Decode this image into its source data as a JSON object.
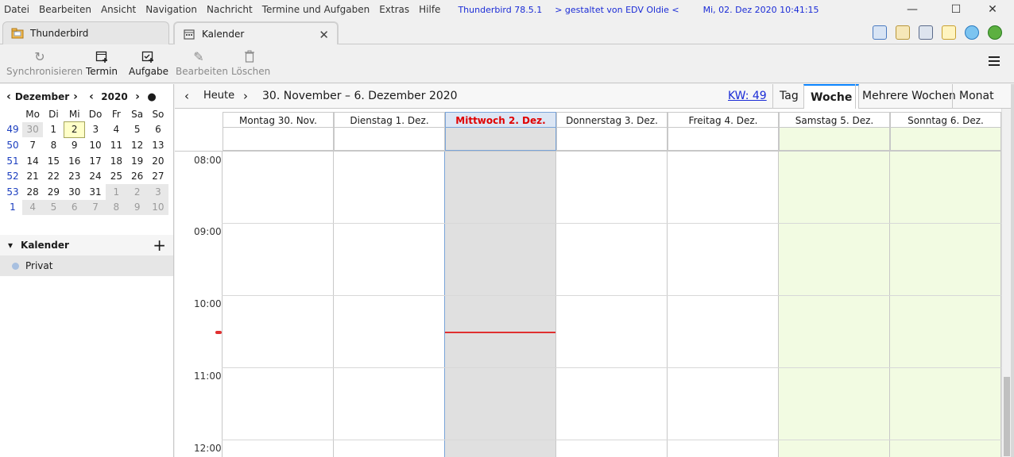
{
  "menubar": {
    "items": [
      "Datei",
      "Bearbeiten",
      "Ansicht",
      "Navigation",
      "Nachricht",
      "Termine und Aufgaben",
      "Extras",
      "Hilfe"
    ],
    "app_version": "Thunderbird 78.5.1",
    "theme": "> gestaltet von EDV Oldie <",
    "datetime": "Mi, 02. Dez 2020   10:41:15"
  },
  "tabs": {
    "mail_label": "Thunderbird",
    "calendar_label": "Kalender",
    "close_glyph": "✕"
  },
  "toolbar": {
    "sync_label": "Synchronisieren",
    "event_label": "Termin",
    "task_label": "Aufgabe",
    "edit_label": "Bearbeiten",
    "delete_label": "Löschen"
  },
  "minical": {
    "month": "Dezember",
    "year": "2020",
    "weekday_headers": [
      "Mo",
      "Di",
      "Mi",
      "Do",
      "Fr",
      "Sa",
      "So"
    ],
    "weeks": [
      {
        "wk": "49",
        "days": [
          "30",
          "1",
          "2",
          "3",
          "4",
          "5",
          "6"
        ]
      },
      {
        "wk": "50",
        "days": [
          "7",
          "8",
          "9",
          "10",
          "11",
          "12",
          "13"
        ]
      },
      {
        "wk": "51",
        "days": [
          "14",
          "15",
          "16",
          "17",
          "18",
          "19",
          "20"
        ]
      },
      {
        "wk": "52",
        "days": [
          "21",
          "22",
          "23",
          "24",
          "25",
          "26",
          "27"
        ]
      },
      {
        "wk": "53",
        "days": [
          "28",
          "29",
          "30",
          "31",
          "1",
          "2",
          "3"
        ]
      },
      {
        "wk": "1",
        "days": [
          "4",
          "5",
          "6",
          "7",
          "8",
          "9",
          "10"
        ]
      }
    ]
  },
  "calendars": {
    "section_label": "Kalender",
    "items": [
      {
        "name": "Privat",
        "color": "#a8c0e0"
      }
    ]
  },
  "nav": {
    "today_label": "Heute",
    "range_label": "30. November – 6. Dezember 2020",
    "week_number": "KW: 49",
    "views": [
      "Tag",
      "Woche",
      "Mehrere Wochen",
      "Monat"
    ],
    "selected_view": "Woche"
  },
  "week": {
    "days": [
      "Montag 30. Nov.",
      "Dienstag 1. Dez.",
      "Mittwoch 2. Dez.",
      "Donnerstag 3. Dez.",
      "Freitag 4. Dez.",
      "Samstag 5. Dez.",
      "Sonntag 6. Dez."
    ],
    "today_index": 2,
    "hours": [
      "08:00",
      "09:00",
      "10:00",
      "11:00",
      "12:00"
    ]
  },
  "colors": {
    "today_text": "#e00000",
    "weekend_bg": "#f2fbe2",
    "now_line": "#e03030",
    "link": "#1a2bd6"
  }
}
